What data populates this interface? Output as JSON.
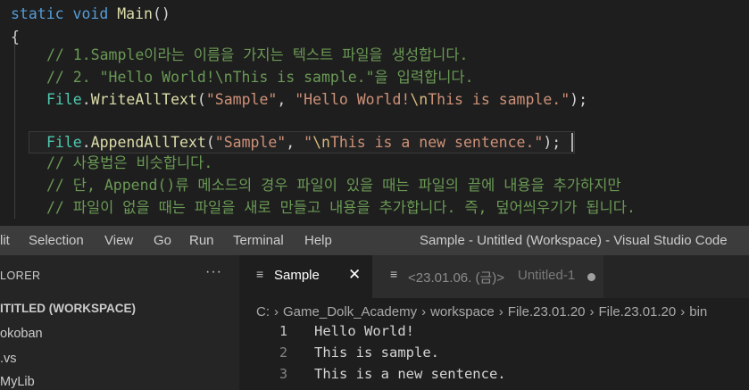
{
  "code": {
    "line1": {
      "kw": "static",
      "kw2": "void",
      "fn": "Main",
      "rest": "()"
    },
    "line2": "{",
    "comment1": "// 1.Sample이라는 이름을 가지는 텍스트 파일을 생성합니다.",
    "comment2": "// 2. \"Hello World!\\nThis is sample.\"을 입력합니다.",
    "write": {
      "cls": "File",
      "fn": "WriteAllText",
      "open": "(",
      "arg1": "\"Sample\"",
      "comma": ", ",
      "s1": "\"Hello World!",
      "esc": "\\n",
      "s2": "This is sample.\"",
      "close": ");"
    },
    "append": {
      "cls": "File",
      "fn": "AppendAllText",
      "open": "(",
      "arg1": "\"Sample\"",
      "comma": ", ",
      "s1": "\"",
      "esc": "\\n",
      "s2": "This is a new sentence.\"",
      "close": ");"
    },
    "comment3": "// 사용법은 비슷합니다.",
    "comment4": "// 단, Append()류 메소드의 경우 파일이 있을 때는 파일의 끝에 내용을 추가하지만",
    "comment5": "// 파일이 없을 때는 파일을 새로 만들고 내용을 추가합니다. 즉, 덮어씌우기가 됩니다."
  },
  "menubar": {
    "items": [
      "lit",
      "Selection",
      "View",
      "Go",
      "Run",
      "Terminal",
      "Help"
    ],
    "window_title": "Sample - Untitled (Workspace) - Visual Studio Code"
  },
  "sidebar": {
    "header": "LORER",
    "more": "···",
    "workspace": "ITITLED (WORKSPACE)",
    "items": [
      "okoban",
      ".vs",
      "MyLib"
    ]
  },
  "tabs": [
    {
      "icon": "≡",
      "label": "Sample",
      "close": "✕"
    },
    {
      "icon": "≡",
      "label": "<23.01.06. (금)>",
      "sub": "Untitled-1"
    }
  ],
  "breadcrumb": [
    "C:",
    "Game_Dolk_Academy",
    "workspace",
    "File.23.01.20",
    "File.23.01.20",
    "bin"
  ],
  "breadcrumb_sep": "›",
  "file_lines": [
    {
      "n": "1",
      "text": "Hello World!"
    },
    {
      "n": "2",
      "text": "This is sample."
    },
    {
      "n": "3",
      "text": "This is a new sentence."
    }
  ],
  "colors": {
    "keyword": "#569cd6",
    "function": "#dcdcaa",
    "comment": "#6a9955",
    "string": "#ce9178",
    "class": "#4ec9b0",
    "escape": "#d7ba7d"
  }
}
